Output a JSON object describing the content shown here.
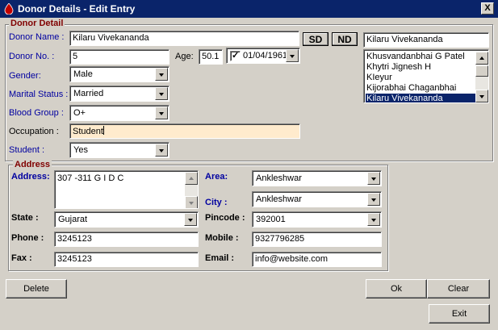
{
  "window": {
    "title": "Donor Details - Edit Entry",
    "close_glyph": "X"
  },
  "donor_detail": {
    "legend": "Donor Detail",
    "donor_name_label": "Donor Name :",
    "donor_name_value": "Kilaru Vivekananda",
    "sd_button": "SD",
    "nd_button": "ND",
    "donor_no_label": "Donor No. :",
    "donor_no_value": "5",
    "age_label": "Age:",
    "age_value": "50.1",
    "dob_checked": true,
    "dob_value": "01/04/1961",
    "gender_label": "Gender:",
    "gender_value": "Male",
    "marital_label": "Marital Status :",
    "marital_value": "Married",
    "blood_group_label": "Blood Group :",
    "blood_group_value": "O+",
    "occupation_label": "Occupation :",
    "occupation_value": "Student",
    "student_label": "Student :",
    "student_value": "Yes"
  },
  "donor_search": {
    "search_value": "Kilaru Vivekananda",
    "list_items": [
      "Khusvandanbhai G Patel",
      "Khytri Jignesh H",
      "KIeyur",
      "Kijorabhai Chaganbhai",
      "Kilaru Vivekananda"
    ],
    "selected_index": 4
  },
  "address": {
    "legend": "Address",
    "address_label": "Address:",
    "address_value": "307 -311 G I D C",
    "area_label": "Area:",
    "area_value": "Ankleshwar",
    "city_label": "City :",
    "city_value": "Ankleshwar",
    "state_label": "State :",
    "state_value": "Gujarat",
    "pincode_label": "Pincode :",
    "pincode_value": "392001",
    "phone_label": "Phone :",
    "phone_value": "3245123",
    "mobile_label": "Mobile :",
    "mobile_value": "9327796285",
    "fax_label": "Fax :",
    "fax_value": "3245123",
    "email_label": "Email :",
    "email_value": "info@website.com"
  },
  "buttons": {
    "delete": "Delete",
    "ok": "Ok",
    "clear": "Clear",
    "exit": "Exit"
  },
  "colors": {
    "title_bar": "#0a246a",
    "window_bg": "#d4d0c8",
    "legend_text": "#800000",
    "label_blue": "#0000a0",
    "occupation_bg": "#ffebcd"
  }
}
